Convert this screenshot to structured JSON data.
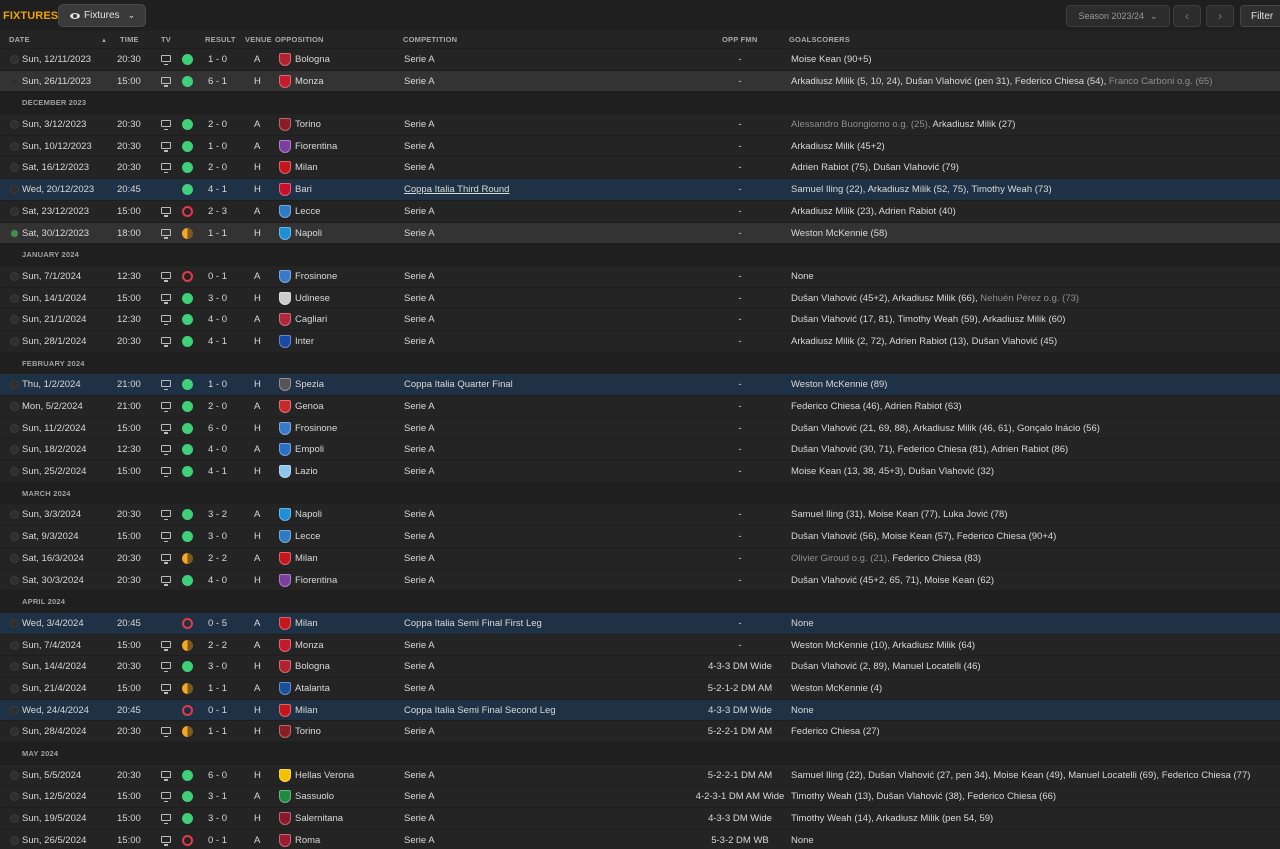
{
  "toolbar": {
    "title": "FIXTURES",
    "view_dropdown": "Fixtures",
    "season": "Season 2023/24",
    "prev": "‹",
    "next": "›",
    "filter": "Filter"
  },
  "columns": {
    "date": "DATE",
    "time": "TIME",
    "tv": "TV",
    "result": "RESULT",
    "venue": "VENUE",
    "opposition": "OPPOSITION",
    "competition": "COMPETITION",
    "opp_fmn": "OPP FMN",
    "goalscorers": "GOALSCORERS"
  },
  "rows": [
    {
      "kind": "match",
      "date": "Sun, 12/11/2023",
      "time": "20:30",
      "tv": true,
      "res": "W",
      "score": "1 - 0",
      "venue": "A",
      "opp": "Bologna",
      "color": "#b3202f",
      "comp": "Serie A",
      "fmn": "-",
      "scorers": [
        [
          "Moise Kean (90+5)",
          false
        ]
      ]
    },
    {
      "kind": "match",
      "date": "Sun, 26/11/2023",
      "time": "15:00",
      "tv": true,
      "res": "W",
      "score": "6 - 1",
      "venue": "H",
      "opp": "Monza",
      "color": "#c41a2d",
      "comp": "Serie A",
      "fmn": "-",
      "style": "sel",
      "scorers": [
        [
          "Arkadiusz Milik (5, 10, 24), Dušan Vlahović (pen 31), Federico Chiesa (54), ",
          false
        ],
        [
          "Franco Carboni o.g. (65)",
          true
        ]
      ]
    },
    {
      "kind": "month",
      "label": "DECEMBER 2023"
    },
    {
      "kind": "match",
      "date": "Sun, 3/12/2023",
      "time": "20:30",
      "tv": true,
      "res": "W",
      "score": "2 - 0",
      "venue": "A",
      "opp": "Torino",
      "color": "#8a1c24",
      "comp": "Serie A",
      "fmn": "-",
      "scorers": [
        [
          "Alessandro Buongiorno o.g. (25), ",
          true
        ],
        [
          "Arkadiusz Milik (27)",
          false
        ]
      ]
    },
    {
      "kind": "match",
      "date": "Sun, 10/12/2023",
      "time": "20:30",
      "tv": true,
      "res": "W",
      "score": "1 - 0",
      "venue": "A",
      "opp": "Fiorentina",
      "color": "#7b3fa0",
      "comp": "Serie A",
      "fmn": "-",
      "scorers": [
        [
          "Arkadiusz Milik (45+2)",
          false
        ]
      ]
    },
    {
      "kind": "match",
      "date": "Sat, 16/12/2023",
      "time": "20:30",
      "tv": true,
      "res": "W",
      "score": "2 - 0",
      "venue": "H",
      "opp": "Milan",
      "color": "#c4161c",
      "comp": "Serie A",
      "fmn": "-",
      "scorers": [
        [
          "Adrien Rabiot (75), Dušan Vlahović (79)",
          false
        ]
      ]
    },
    {
      "kind": "match",
      "date": "Wed, 20/12/2023",
      "time": "20:45",
      "tv": false,
      "res": "W",
      "score": "4 - 1",
      "venue": "H",
      "opp": "Bari",
      "color": "#c8102e",
      "comp": "Coppa Italia Third Round",
      "comp_u": true,
      "fmn": "-",
      "style": "hl",
      "scorers": [
        [
          "Samuel Iling (22), Arkadiusz Milik (52, 75), Timothy Weah (73)",
          false
        ]
      ]
    },
    {
      "kind": "match",
      "date": "Sat, 23/12/2023",
      "time": "15:00",
      "tv": true,
      "res": "L",
      "score": "2 - 3",
      "venue": "A",
      "opp": "Lecce",
      "color": "#2e7bc4",
      "comp": "Serie A",
      "fmn": "-",
      "scorers": [
        [
          "Arkadiusz Milik (23), Adrien Rabiot (40)",
          false
        ]
      ]
    },
    {
      "kind": "match",
      "date": "Sat, 30/12/2023",
      "time": "18:00",
      "tv": true,
      "res": "D",
      "score": "1 - 1",
      "venue": "H",
      "opp": "Napoli",
      "color": "#1f8fd6",
      "comp": "Serie A",
      "fmn": "-",
      "style": "sel",
      "live": true,
      "scorers": [
        [
          "Weston McKennie (58)",
          false
        ]
      ]
    },
    {
      "kind": "month",
      "label": "JANUARY 2024"
    },
    {
      "kind": "match",
      "date": "Sun, 7/1/2024",
      "time": "12:30",
      "tv": true,
      "res": "L",
      "score": "0 - 1",
      "venue": "A",
      "opp": "Frosinone",
      "color": "#3a78c8",
      "comp": "Serie A",
      "fmn": "-",
      "scorers": [
        [
          "None",
          false
        ]
      ]
    },
    {
      "kind": "match",
      "date": "Sun, 14/1/2024",
      "time": "15:00",
      "tv": true,
      "res": "W",
      "score": "3 - 0",
      "venue": "H",
      "opp": "Udinese",
      "color": "#cccccc",
      "comp": "Serie A",
      "fmn": "-",
      "scorers": [
        [
          "Dušan Vlahović (45+2), Arkadiusz Milik (66), ",
          false
        ],
        [
          "Nehuén Pérez o.g. (73)",
          true
        ]
      ]
    },
    {
      "kind": "match",
      "date": "Sun, 21/1/2024",
      "time": "12:30",
      "tv": true,
      "res": "W",
      "score": "4 - 0",
      "venue": "A",
      "opp": "Cagliari",
      "color": "#b0263a",
      "comp": "Serie A",
      "fmn": "-",
      "scorers": [
        [
          "Dušan Vlahović (17, 81), Timothy Weah (59), Arkadiusz Milik (60)",
          false
        ]
      ]
    },
    {
      "kind": "match",
      "date": "Sun, 28/1/2024",
      "time": "20:30",
      "tv": true,
      "res": "W",
      "score": "4 - 1",
      "venue": "H",
      "opp": "Inter",
      "color": "#1848a8",
      "comp": "Serie A",
      "fmn": "-",
      "scorers": [
        [
          "Arkadiusz Milik (2, 72), Adrien Rabiot (13), Dušan Vlahović (45)",
          false
        ]
      ]
    },
    {
      "kind": "month",
      "label": "FEBRUARY 2024"
    },
    {
      "kind": "match",
      "date": "Thu, 1/2/2024",
      "time": "21:00",
      "tv": true,
      "res": "W",
      "score": "1 - 0",
      "venue": "H",
      "opp": "Spezia",
      "color": "#555555",
      "comp": "Coppa Italia Quarter Final",
      "fmn": "-",
      "style": "hl",
      "scorers": [
        [
          "Weston McKennie (89)",
          false
        ]
      ]
    },
    {
      "kind": "match",
      "date": "Mon, 5/2/2024",
      "time": "21:00",
      "tv": true,
      "res": "W",
      "score": "2 - 0",
      "venue": "A",
      "opp": "Genoa",
      "color": "#c42a2a",
      "comp": "Serie A",
      "fmn": "-",
      "scorers": [
        [
          "Federico Chiesa (46), Adrien Rabiot (63)",
          false
        ]
      ]
    },
    {
      "kind": "match",
      "date": "Sun, 11/2/2024",
      "time": "15:00",
      "tv": true,
      "res": "W",
      "score": "6 - 0",
      "venue": "H",
      "opp": "Frosinone",
      "color": "#3a78c8",
      "comp": "Serie A",
      "fmn": "-",
      "scorers": [
        [
          "Dušan Vlahović (21, 69, 88), Arkadiusz Milik (46, 61), Gonçalo Inácio (56)",
          false
        ]
      ]
    },
    {
      "kind": "match",
      "date": "Sun, 18/2/2024",
      "time": "12:30",
      "tv": true,
      "res": "W",
      "score": "4 - 0",
      "venue": "A",
      "opp": "Empoli",
      "color": "#2a6fc4",
      "comp": "Serie A",
      "fmn": "-",
      "scorers": [
        [
          "Dušan Vlahović (30, 71), Federico Chiesa (81), Adrien Rabiot (86)",
          false
        ]
      ]
    },
    {
      "kind": "match",
      "date": "Sun, 25/2/2024",
      "time": "15:00",
      "tv": true,
      "res": "W",
      "score": "4 - 1",
      "venue": "H",
      "opp": "Lazio",
      "color": "#8ec5ea",
      "comp": "Serie A",
      "fmn": "-",
      "scorers": [
        [
          "Moise Kean (13, 38, 45+3), Dušan Vlahović (32)",
          false
        ]
      ]
    },
    {
      "kind": "month",
      "label": "MARCH 2024"
    },
    {
      "kind": "match",
      "date": "Sun, 3/3/2024",
      "time": "20:30",
      "tv": true,
      "res": "W",
      "score": "3 - 2",
      "venue": "A",
      "opp": "Napoli",
      "color": "#1f8fd6",
      "comp": "Serie A",
      "fmn": "-",
      "scorers": [
        [
          "Samuel Iling (31), Moise Kean (77), Luka Jović (78)",
          false
        ]
      ]
    },
    {
      "kind": "match",
      "date": "Sat, 9/3/2024",
      "time": "15:00",
      "tv": true,
      "res": "W",
      "score": "3 - 0",
      "venue": "H",
      "opp": "Lecce",
      "color": "#2e7bc4",
      "comp": "Serie A",
      "fmn": "-",
      "scorers": [
        [
          "Dušan Vlahović (56), Moise Kean (57), Federico Chiesa (90+4)",
          false
        ]
      ]
    },
    {
      "kind": "match",
      "date": "Sat, 16/3/2024",
      "time": "20:30",
      "tv": true,
      "res": "D",
      "score": "2 - 2",
      "venue": "A",
      "opp": "Milan",
      "color": "#c4161c",
      "comp": "Serie A",
      "fmn": "-",
      "scorers": [
        [
          "Olivier Giroud o.g. (21), ",
          true
        ],
        [
          "Federico Chiesa (83)",
          false
        ]
      ]
    },
    {
      "kind": "match",
      "date": "Sat, 30/3/2024",
      "time": "20:30",
      "tv": true,
      "res": "W",
      "score": "4 - 0",
      "venue": "H",
      "opp": "Fiorentina",
      "color": "#7b3fa0",
      "comp": "Serie A",
      "fmn": "-",
      "scorers": [
        [
          "Dušan Vlahović (45+2, 65, 71), Moise Kean (62)",
          false
        ]
      ]
    },
    {
      "kind": "month",
      "label": "APRIL 2024"
    },
    {
      "kind": "match",
      "date": "Wed, 3/4/2024",
      "time": "20:45",
      "tv": false,
      "res": "L",
      "score": "0 - 5",
      "venue": "A",
      "opp": "Milan",
      "color": "#c4161c",
      "comp": "Coppa Italia Semi Final First Leg",
      "fmn": "-",
      "style": "hl",
      "scorers": [
        [
          "None",
          false
        ]
      ]
    },
    {
      "kind": "match",
      "date": "Sun, 7/4/2024",
      "time": "15:00",
      "tv": true,
      "res": "D",
      "score": "2 - 2",
      "venue": "A",
      "opp": "Monza",
      "color": "#c41a2d",
      "comp": "Serie A",
      "fmn": "-",
      "scorers": [
        [
          "Weston McKennie (10), Arkadiusz Milik (64)",
          false
        ]
      ]
    },
    {
      "kind": "match",
      "date": "Sun, 14/4/2024",
      "time": "20:30",
      "tv": true,
      "res": "W",
      "score": "3 - 0",
      "venue": "H",
      "opp": "Bologna",
      "color": "#b3202f",
      "comp": "Serie A",
      "fmn": "4-3-3 DM Wide",
      "scorers": [
        [
          "Dušan Vlahović (2, 89), Manuel Locatelli (46)",
          false
        ]
      ]
    },
    {
      "kind": "match",
      "date": "Sun, 21/4/2024",
      "time": "15:00",
      "tv": true,
      "res": "D",
      "score": "1 - 1",
      "venue": "A",
      "opp": "Atalanta",
      "color": "#1a4fa0",
      "comp": "Serie A",
      "fmn": "5-2-1-2 DM AM",
      "scorers": [
        [
          "Weston McKennie (4)",
          false
        ]
      ]
    },
    {
      "kind": "match",
      "date": "Wed, 24/4/2024",
      "time": "20:45",
      "tv": false,
      "res": "L",
      "score": "0 - 1",
      "venue": "H",
      "opp": "Milan",
      "color": "#c4161c",
      "comp": "Coppa Italia Semi Final Second Leg",
      "fmn": "4-3-3 DM Wide",
      "style": "hl",
      "scorers": [
        [
          "None",
          false
        ]
      ]
    },
    {
      "kind": "match",
      "date": "Sun, 28/4/2024",
      "time": "20:30",
      "tv": true,
      "res": "D",
      "score": "1 - 1",
      "venue": "H",
      "opp": "Torino",
      "color": "#8a1c24",
      "comp": "Serie A",
      "fmn": "5-2-2-1 DM AM",
      "scorers": [
        [
          "Federico Chiesa (27)",
          false
        ]
      ]
    },
    {
      "kind": "month",
      "label": "MAY 2024"
    },
    {
      "kind": "match",
      "date": "Sun, 5/5/2024",
      "time": "20:30",
      "tv": true,
      "res": "W",
      "score": "6 - 0",
      "venue": "H",
      "opp": "Hellas Verona",
      "color": "#f2c200",
      "comp": "Serie A",
      "fmn": "5-2-2-1 DM AM",
      "scorers": [
        [
          "Samuel Iling (22), Dušan Vlahović (27, pen 34), Moise Kean (49), Manuel Locatelli (69), Federico Chiesa (77)",
          false
        ]
      ]
    },
    {
      "kind": "match",
      "date": "Sun, 12/5/2024",
      "time": "15:00",
      "tv": true,
      "res": "W",
      "score": "3 - 1",
      "venue": "A",
      "opp": "Sassuolo",
      "color": "#1f8a3e",
      "comp": "Serie A",
      "fmn": "4-2-3-1 DM AM Wide",
      "scorers": [
        [
          "Timothy Weah (13), Dušan Vlahović (38), Federico Chiesa (66)",
          false
        ]
      ]
    },
    {
      "kind": "match",
      "date": "Sun, 19/5/2024",
      "time": "15:00",
      "tv": true,
      "res": "W",
      "score": "3 - 0",
      "venue": "H",
      "opp": "Salernitana",
      "color": "#8a1a2a",
      "comp": "Serie A",
      "fmn": "4-3-3 DM Wide",
      "scorers": [
        [
          "Timothy Weah (14), Arkadiusz Milik (pen 54, 59)",
          false
        ]
      ]
    },
    {
      "kind": "match",
      "date": "Sun, 26/5/2024",
      "time": "15:00",
      "tv": true,
      "res": "L",
      "score": "0 - 1",
      "venue": "A",
      "opp": "Roma",
      "color": "#9b1b30",
      "comp": "Serie A",
      "fmn": "5-3-2 DM WB",
      "scorers": [
        [
          "None",
          false
        ]
      ]
    }
  ]
}
